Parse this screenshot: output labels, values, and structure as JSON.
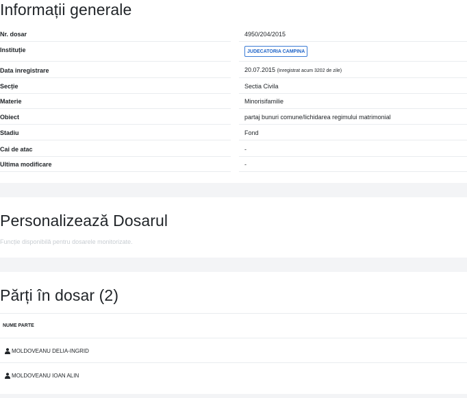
{
  "info_section": {
    "title": "Informații generale",
    "rows": [
      {
        "label": "Nr. dosar",
        "value": "4950/204/2015"
      },
      {
        "label": "Instituție",
        "badge": "JUDECATORIA CAMPINA"
      },
      {
        "label": "Data inregistrare",
        "value": "20.07.2015",
        "note": "(Inregistrat acum 3202 de zile)"
      },
      {
        "label": "Secție",
        "value": "Sectia Civila"
      },
      {
        "label": "Materie",
        "value": "Minorisifamilie"
      },
      {
        "label": "Obiect",
        "value": "partaj bunuri comune/lichidarea regimului matrimonial"
      },
      {
        "label": "Stadiu",
        "value": "Fond"
      },
      {
        "label": "Cai de atac",
        "value": "-"
      },
      {
        "label": "Ultima modificare",
        "value": "-"
      }
    ],
    "badge_color": "#1e63c7"
  },
  "custom_section": {
    "title": "Personalizează Dosarul",
    "note": "Funcție disponibilă pentru dosarele monitorizate."
  },
  "parties_section": {
    "title": "Părți în dosar (2)",
    "column_header": "NUME PARTE",
    "parties": [
      {
        "name": "MOLDOVEANU DELIA-INGRID",
        "icon": "user-icon"
      },
      {
        "name": "MOLDOVEANU IOAN ALIN",
        "icon": "user-icon"
      }
    ]
  }
}
